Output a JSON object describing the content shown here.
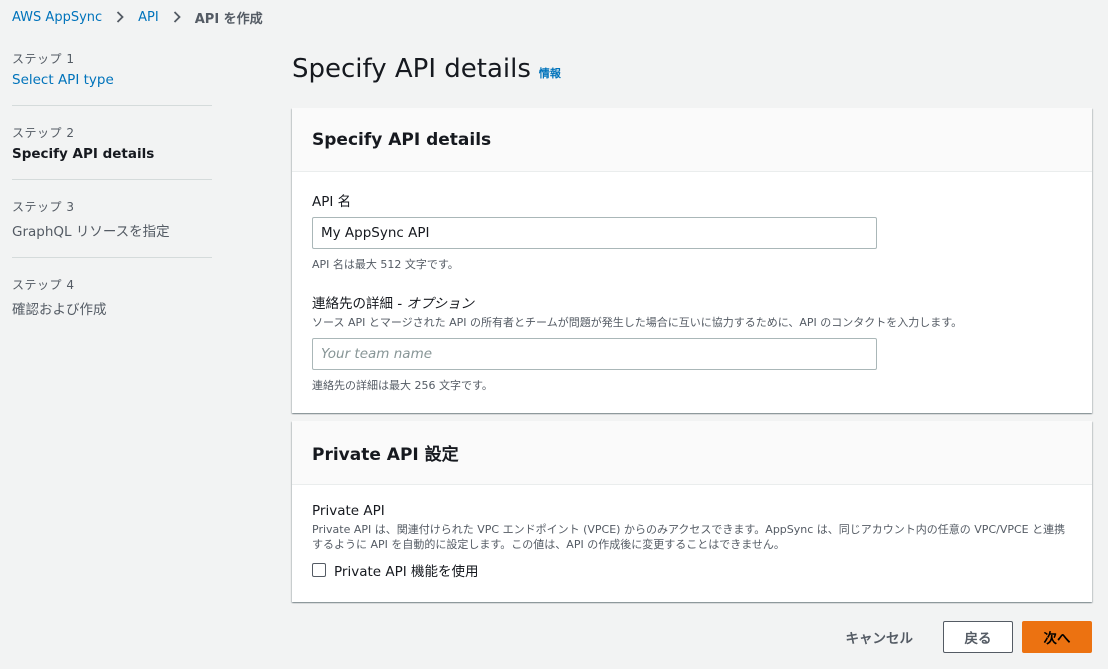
{
  "breadcrumb": {
    "items": [
      "AWS AppSync",
      "API"
    ],
    "current": "API を作成"
  },
  "steps": [
    {
      "num": "ステップ 1",
      "label": "Select API type"
    },
    {
      "num": "ステップ 2",
      "label": "Specify API details"
    },
    {
      "num": "ステップ 3",
      "label": "GraphQL リソースを指定"
    },
    {
      "num": "ステップ 4",
      "label": "確認および作成"
    }
  ],
  "page": {
    "title": "Specify API details",
    "info": "情報"
  },
  "details_panel": {
    "heading": "Specify API details",
    "api_name_label": "API 名",
    "api_name_value": "My AppSync API",
    "api_name_constraint": "API 名は最大 512 文字です。",
    "contact_label": "連絡先の詳細",
    "contact_optional": " - オプション",
    "contact_desc": "ソース API とマージされた API の所有者とチームが問題が発生した場合に互いに協力するために、API のコンタクトを入力します。",
    "contact_placeholder": "Your team name",
    "contact_constraint": "連絡先の詳細は最大 256 文字です。"
  },
  "private_panel": {
    "heading": "Private API 設定",
    "label": "Private API",
    "desc": "Private API は、関連付けられた VPC エンドポイント (VPCE) からのみアクセスできます。AppSync は、同じアカウント内の任意の VPC/VPCE と連携するように API を自動的に設定します。この値は、API の作成後に変更することはできません。",
    "checkbox_label": "Private API 機能を使用"
  },
  "actions": {
    "cancel": "キャンセル",
    "back": "戻る",
    "next": "次へ"
  }
}
